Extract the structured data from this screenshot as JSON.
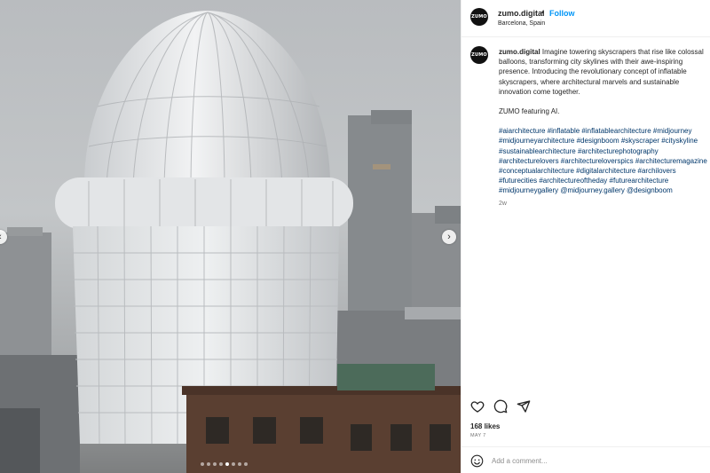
{
  "post": {
    "username": "zumo.digital",
    "avatar_text": "ZUMO",
    "separator": "•",
    "follow_label": "Follow",
    "location": "Barcelona, Spain"
  },
  "caption": {
    "username": "zumo.digital",
    "lines": [
      "Imagine towering skyscrapers that rise like colossal",
      "balloons, transforming city skylines with their awe-inspiring",
      "presence. Introducing the revolutionary concept of inflatable",
      "skyscrapers, where architectural marvels and sustainable",
      "innovation come together."
    ],
    "credit": "ZUMO featuring AI.",
    "hashtag_lines": [
      "#aiarchitecture #inflatable #inflatablearchitecture #midjourney",
      "#midjourneyarchitecture #designboom #skyscraper #cityskyline",
      "#sustainablearchitecture #architecturephotography",
      "#architecturelovers #architectureloverspics #architecturemagazine",
      "#conceptualarchitecture #digitalarchitecture #archilovers",
      "#futurecities #architectureoftheday #futurearchitecture",
      "#midjourneygallery @midjourney.gallery @designboom"
    ],
    "time_ago": "2w"
  },
  "engagement": {
    "likes": "168 likes",
    "date": "MAY 7"
  },
  "comment": {
    "placeholder": "Add a comment..."
  },
  "icons": {
    "like": "heart-icon",
    "comment": "comment-icon",
    "share": "share-icon",
    "emoji": "emoji-icon",
    "next": "chevron-right-icon",
    "prev": "chevron-left-icon"
  },
  "carousel": {
    "total": 8,
    "active_index": 4
  },
  "colors": {
    "accent": "#0095f6",
    "tag": "#00376b",
    "muted": "#737373"
  }
}
